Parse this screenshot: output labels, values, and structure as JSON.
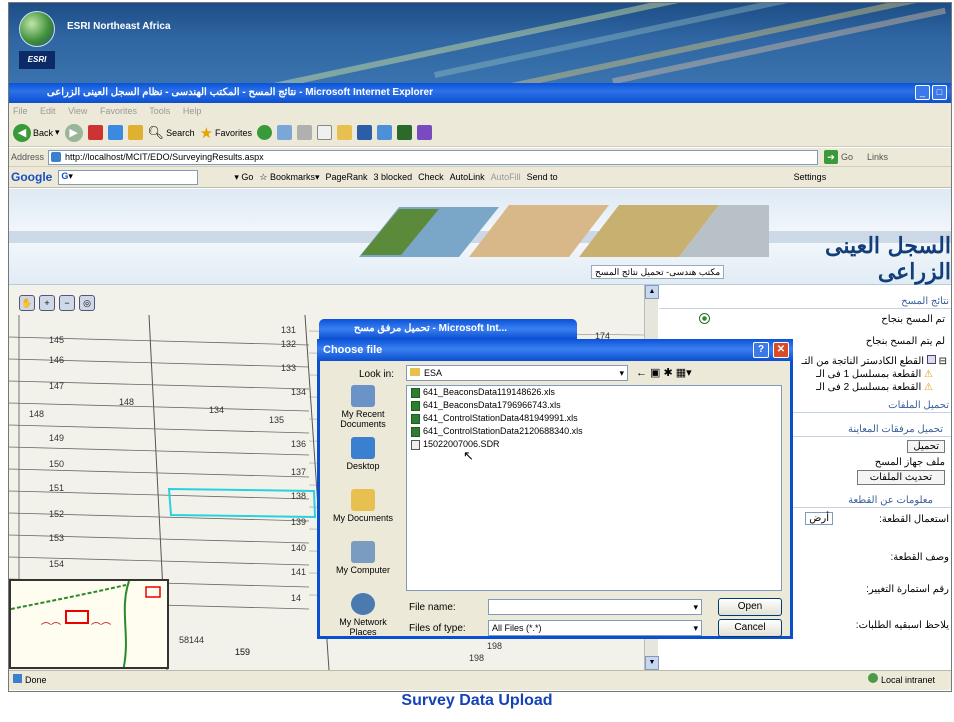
{
  "banner": {
    "org": "ESRI Northeast Africa",
    "logo_text": "ESRI"
  },
  "browser": {
    "title": "نتائج المسح - المكتب الهندسى - نظام السجل العينى الزراعى - Microsoft Internet Explorer",
    "menu": [
      "File",
      "Edit",
      "View",
      "Favorites",
      "Tools",
      "Help"
    ],
    "toolbar": {
      "back": "Back",
      "search": "Search",
      "favorites": "Favorites"
    },
    "address_label": "Address",
    "address": "http://localhost/MCIT/EDO/SurveyingResults.aspx",
    "go": "Go",
    "links": "Links",
    "google": {
      "logo": "Google",
      "prefix": "G",
      "go": "Go",
      "bookmarks": "Bookmarks",
      "pagerank": "PageRank",
      "blocked": "3 blocked",
      "check": "Check",
      "autolink": "AutoLink",
      "autofill": "AutoFill",
      "sendto": "Send to",
      "settings": "Settings"
    },
    "status": "Done",
    "zone": "Local intranet"
  },
  "site": {
    "brand": "السجل العينى الزراعى",
    "nav": "مكتب هندسى- تحميل نتائج المسح"
  },
  "map": {
    "parcels_left": [
      "145",
      "146",
      "147",
      "148",
      "148",
      "149",
      "150",
      "151",
      "152",
      "153",
      "154"
    ],
    "parcels_mid": [
      "131",
      "132",
      "133",
      "134",
      "134",
      "135",
      "136",
      "137",
      "138",
      "139",
      "140",
      "141",
      "14"
    ],
    "parcels_right": [
      "174",
      "159",
      "198",
      "198"
    ],
    "bottom": [
      "58144",
      "159"
    ]
  },
  "panel": {
    "section_results": "نتائج المسح",
    "surveyed": "تم المسح بنجاح",
    "not_surveyed": "لم يتم المسح بنجاح",
    "cadastral": "القطع الكادستر الناتجة من التـ",
    "piece1": "القطعة بمسلسل 1 فى الـ",
    "piece2": "القطعة بمسلسل 2 فى الـ",
    "section_upload": "تحميل الملفات",
    "section_attach": "تحميل مرفقات المعاينة",
    "upload_btn": "تحميل",
    "device_file": "ملف جهاز المسح",
    "update_btn": "تحديث الملفات",
    "section_info": "معلومات عن القطعة",
    "usage": "استعمال القطعة:",
    "usage_val": "أرض",
    "desc": "وصف القطعة:",
    "form_no": "رقم استمارة التغيير:",
    "notes": "يلاحظ اسبقيه الطلبات:"
  },
  "small_dialog": {
    "title": "تحميل مرفق مسح - Microsoft Int..."
  },
  "dialog": {
    "title": "Choose file",
    "look_in_label": "Look in:",
    "look_in": "ESA",
    "places": [
      "My Recent Documents",
      "Desktop",
      "My Documents",
      "My Computer",
      "My Network Places"
    ],
    "files": [
      "641_BeaconsData119148626.xls",
      "641_BeaconsData1796966743.xls",
      "641_ControlStationData481949991.xls",
      "641_ControlStationData2120688340.xls",
      "15022007006.SDR"
    ],
    "filename_label": "File name:",
    "filename": "",
    "filetype_label": "Files of type:",
    "filetype": "All Files (*.*)",
    "open": "Open",
    "cancel": "Cancel"
  },
  "caption": "Survey Data Upload"
}
